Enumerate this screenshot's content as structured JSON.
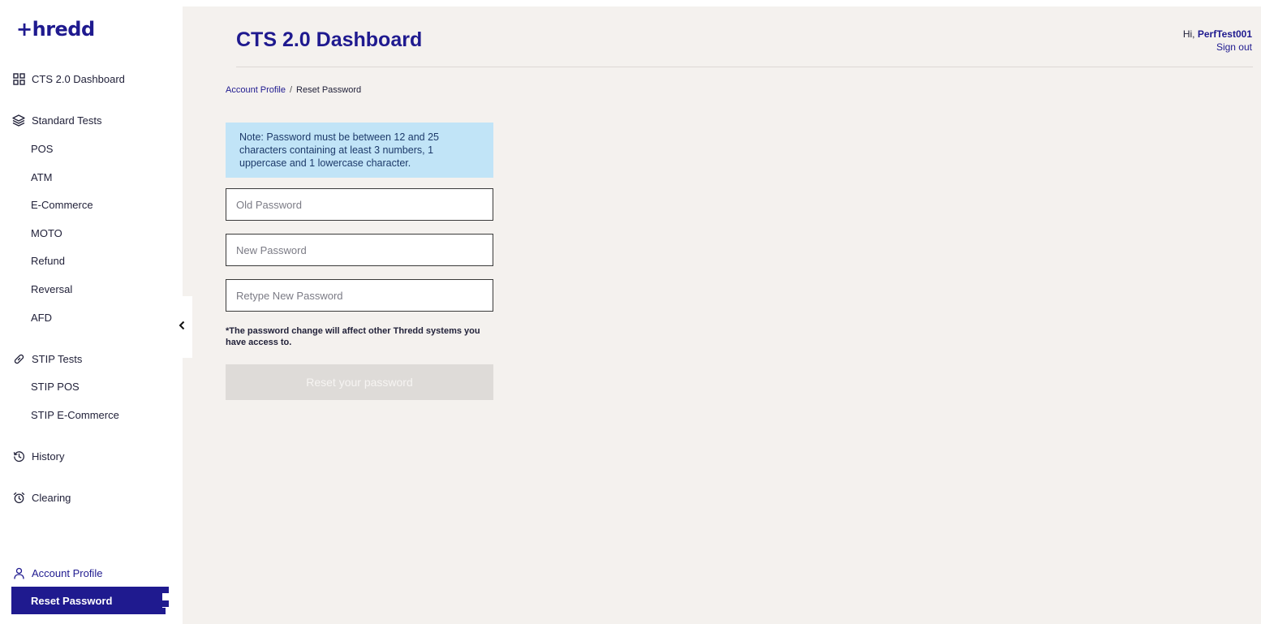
{
  "brand": {
    "logo_text": "+hredd"
  },
  "sidebar": {
    "dashboard_label": "CTS 2.0 Dashboard",
    "standard_tests_label": "Standard Tests",
    "standard_tests_items": [
      "POS",
      "ATM",
      "E-Commerce",
      "MOTO",
      "Refund",
      "Reversal",
      "AFD"
    ],
    "stip_tests_label": "STIP Tests",
    "stip_tests_items": [
      "STIP POS",
      "STIP E-Commerce"
    ],
    "history_label": "History",
    "clearing_label": "Clearing",
    "account_profile_label": "Account Profile",
    "reset_password_label": "Reset Password"
  },
  "header": {
    "title": "CTS 2.0 Dashboard",
    "greeting": "Hi,",
    "username": "PerfTest001",
    "sign_out": "Sign out"
  },
  "breadcrumb": {
    "parent": "Account Profile",
    "separator": "/",
    "current": "Reset Password"
  },
  "form": {
    "note": "Note: Password must be between 12 and 25 characters containing at least 3 numbers, 1 uppercase and 1 lowercase character.",
    "old_password_placeholder": "Old Password",
    "new_password_placeholder": "New Password",
    "retype_password_placeholder": "Retype New Password",
    "disclaimer": "*The password change will affect other Thredd systems you have access to.",
    "submit_label": "Reset your password"
  },
  "colors": {
    "brand": "#1f1a8f",
    "content_bg": "#f4f1ee",
    "note_bg": "#c1e4f7",
    "button_disabled": "#dedbd8"
  }
}
